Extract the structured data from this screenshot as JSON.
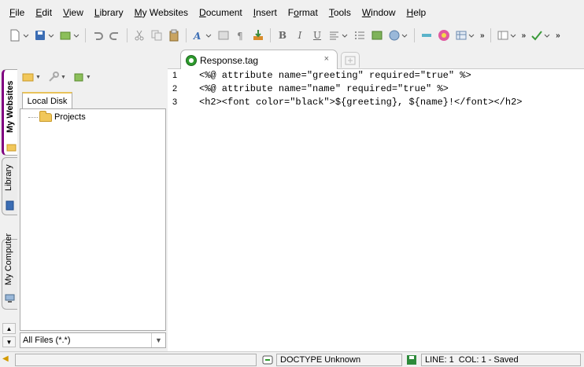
{
  "menu": [
    {
      "label": "File",
      "accel": "F"
    },
    {
      "label": "Edit",
      "accel": "E"
    },
    {
      "label": "View",
      "accel": "V"
    },
    {
      "label": "Library",
      "accel": "L"
    },
    {
      "label": "My Websites",
      "accel": "M"
    },
    {
      "label": "Document",
      "accel": "D"
    },
    {
      "label": "Insert",
      "accel": "I"
    },
    {
      "label": "Format",
      "accel": "o"
    },
    {
      "label": "Tools",
      "accel": "T"
    },
    {
      "label": "Window",
      "accel": "W"
    },
    {
      "label": "Help",
      "accel": "H"
    }
  ],
  "toolbar": {
    "bold_label": "B",
    "italic_label": "I",
    "underline_label": "U",
    "overflow_label": "»"
  },
  "editor_tab": {
    "label": "Response.tag",
    "close_glyph": "×"
  },
  "side_tabs": [
    {
      "label": "My Websites",
      "active": true
    },
    {
      "label": "Library",
      "active": false
    },
    {
      "label": "My Computer",
      "active": false
    }
  ],
  "panel": {
    "disk_tab": "Local Disk",
    "tree": [
      {
        "label": "Projects"
      }
    ],
    "filter": "All Files (*.*)"
  },
  "editor": {
    "lines": [
      {
        "num": "1",
        "text": "<%@ attribute name=\"greeting\" required=\"true\" %>"
      },
      {
        "num": "2",
        "text": "<%@ attribute name=\"name\" required=\"true\" %>"
      },
      {
        "num": "3",
        "text": "<h2><font color=\"black\">${greeting}, ${name}!</font></h2>"
      }
    ]
  },
  "status": {
    "doctype": "DOCTYPE Unknown",
    "position": "LINE: 1  COL: 1 - Saved"
  },
  "colors": {
    "tag_icon": "#2d9a2d",
    "folder": "#f1c75a",
    "accent_side_tab": "#800080"
  }
}
